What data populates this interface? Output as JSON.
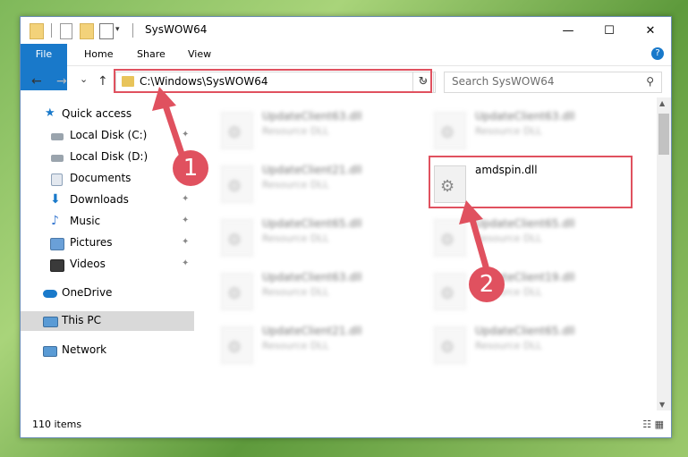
{
  "window": {
    "title": "SysWOW64",
    "controls": {
      "minimize": "—",
      "maximize": "☐",
      "close": "✕"
    }
  },
  "ribbon": {
    "tabs": [
      "File",
      "Home",
      "Share",
      "View"
    ],
    "help": "?"
  },
  "nav": {
    "back": "←",
    "forward": "→",
    "recent": "⌄",
    "up": "↑",
    "address": "C:\\Windows\\SysWOW64",
    "address_dropdown": "⌄",
    "refresh": "↻",
    "search_placeholder": "Search SysWOW64",
    "search_icon": "⚲"
  },
  "sidebar": {
    "items": [
      {
        "label": "Quick access",
        "icon": "star-icon",
        "pinned": false
      },
      {
        "label": "Local Disk (C:)",
        "icon": "drive-icon",
        "pinned": true
      },
      {
        "label": "Local Disk (D:)",
        "icon": "drive-icon",
        "pinned": false
      },
      {
        "label": "Documents",
        "icon": "documents-icon",
        "pinned": true
      },
      {
        "label": "Downloads",
        "icon": "downloads-icon",
        "pinned": true
      },
      {
        "label": "Music",
        "icon": "music-icon",
        "pinned": true
      },
      {
        "label": "Pictures",
        "icon": "pictures-icon",
        "pinned": true
      },
      {
        "label": "Videos",
        "icon": "videos-icon",
        "pinned": true
      },
      {
        "label": "OneDrive",
        "icon": "cloud-icon",
        "pinned": false
      },
      {
        "label": "This PC",
        "icon": "computer-icon",
        "pinned": false,
        "selected": true
      },
      {
        "label": "Network",
        "icon": "network-icon",
        "pinned": false
      }
    ],
    "pin_glyph": "📌"
  },
  "files": [
    {
      "name": "UpdateClient63.dll",
      "type": "Resource DLL",
      "blurred": true
    },
    {
      "name": "UpdateClient63.dll",
      "type": "Resource DLL",
      "blurred": true
    },
    {
      "name": "UpdateClient21.dll",
      "type": "Resource DLL",
      "blurred": true
    },
    {
      "name": "amdspin.dll",
      "type": "",
      "blurred": false
    },
    {
      "name": "UpdateClient65.dll",
      "type": "Resource DLL",
      "blurred": true
    },
    {
      "name": "UpdateClient65.dll",
      "type": "Resource DLL",
      "blurred": true
    },
    {
      "name": "UpdateClient63.dll",
      "type": "Resource DLL",
      "blurred": true
    },
    {
      "name": "UpdateClient19.dll",
      "type": "Resource DLL",
      "blurred": true
    },
    {
      "name": "UpdateClient21.dll",
      "type": "Resource DLL",
      "blurred": true
    },
    {
      "name": "UpdateClient65.dll",
      "type": "Resource DLL",
      "blurred": true
    }
  ],
  "status": {
    "count": "110 items",
    "views": "☷ ▦"
  },
  "annotations": {
    "badge1": "1",
    "badge2": "2",
    "color": "#e0515f"
  }
}
